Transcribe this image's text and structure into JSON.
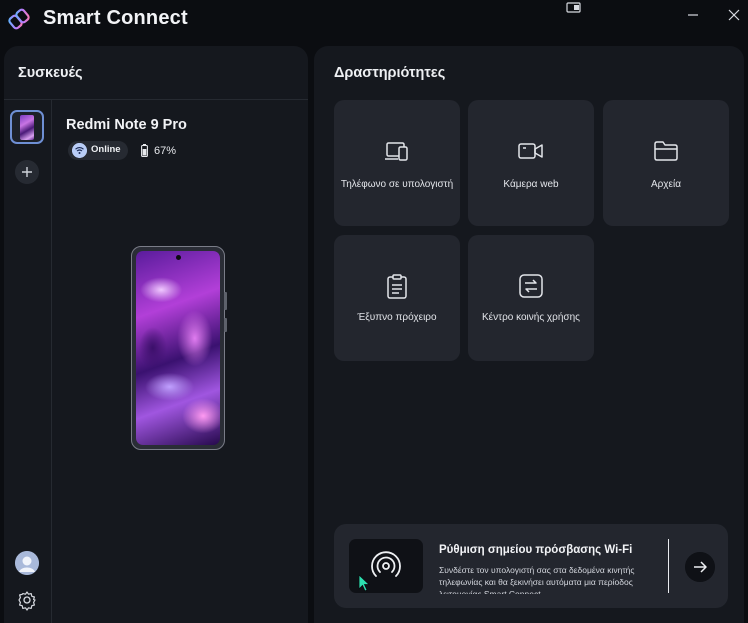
{
  "app": {
    "title": "Smart Connect"
  },
  "window_controls": {
    "minimize_icon": "minimize-icon",
    "close_icon": "close-icon",
    "snap_icon": "snap-layout-icon"
  },
  "devices_panel": {
    "title": "Συσκευές",
    "device": {
      "name": "Redmi Note 9 Pro",
      "status": "Online",
      "battery": "67%"
    },
    "rail": {
      "add_icon": "plus-icon",
      "avatar_icon": "user-avatar-icon",
      "settings_icon": "gear-icon"
    }
  },
  "activities_panel": {
    "title": "Δραστηριότητες",
    "tiles": [
      {
        "label": "Τηλέφωνο σε υπολογιστή",
        "icon": "phone-to-pc-icon"
      },
      {
        "label": "Κάμερα web",
        "icon": "video-camera-icon"
      },
      {
        "label": "Αρχεία",
        "icon": "folder-icon"
      },
      {
        "label": "Έξυπνο πρόχειρο",
        "icon": "clipboard-icon"
      },
      {
        "label": "Κέντρο κοινής χρήσης",
        "icon": "share-hub-icon"
      }
    ],
    "hotspot": {
      "title": "Ρύθμιση σημείου πρόσβασης Wi-Fi",
      "description": "Συνδέστε τον υπολογιστή σας στα δεδομένα κινητής τηλεφωνίας και θα ξεκινήσει αυτόματα μια περίοδος λειτουργίας Smart Connect",
      "icon": "hotspot-icon",
      "action_icon": "arrow-right-icon"
    }
  },
  "colors": {
    "background": "#0b0d11",
    "panel": "#15181e",
    "tile": "#23262e",
    "accent": "#6e8fd4",
    "cursor": "#2de0b0"
  }
}
